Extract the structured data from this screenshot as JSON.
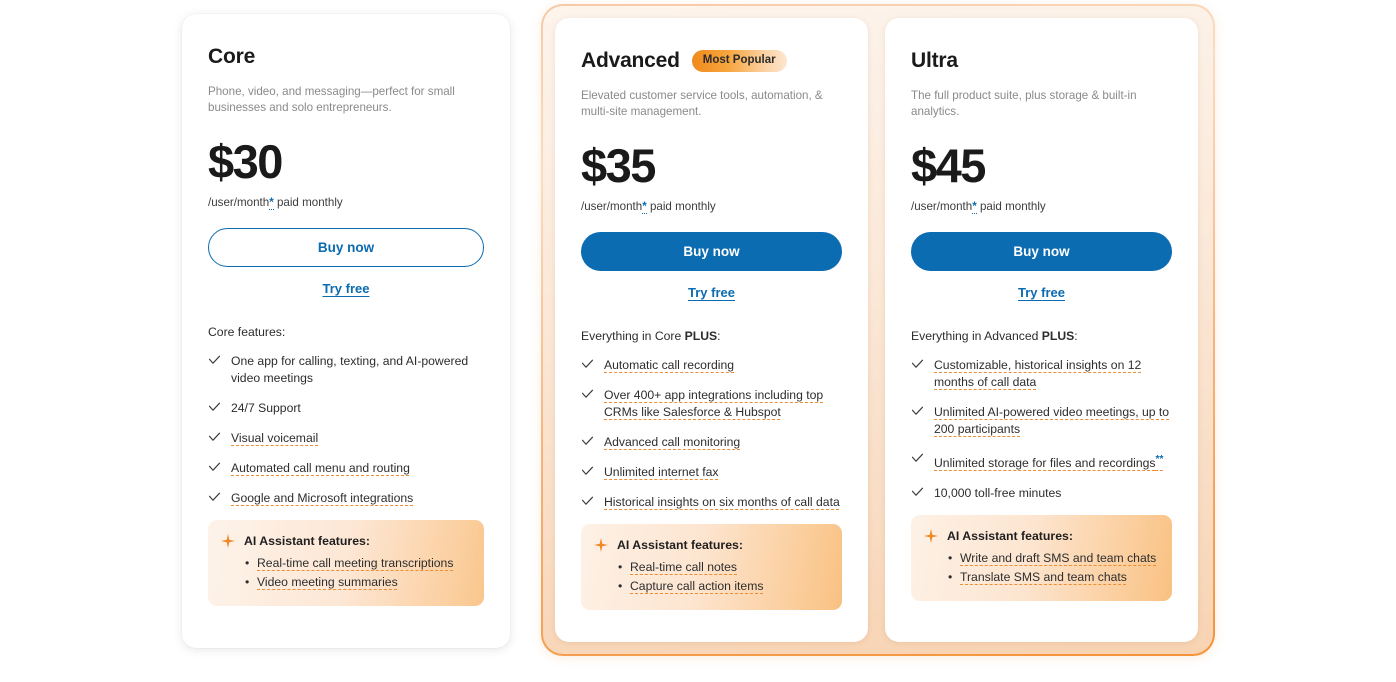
{
  "colors": {
    "brand_blue": "#0b6bb0",
    "accent_orange": "#ef8d33",
    "badge_orange": "#f08a1c",
    "text_dark": "#1a1a1a",
    "text_muted": "#8a8a8a"
  },
  "plans": [
    {
      "id": "core",
      "name": "Core",
      "badge": null,
      "description": "Phone, video, and messaging—perfect for small businesses and solo entrepreneurs.",
      "price": "$30",
      "price_note_prefix": "/user/month",
      "price_note_asterisk": "*",
      "price_note_suffix": " paid monthly",
      "buy_label": "Buy now",
      "try_label": "Try free",
      "features_intro": "Core features:",
      "features_intro_bold": "",
      "features_intro_suffix": "",
      "features": [
        {
          "text": "One app for calling, texting, and AI-powered video meetings",
          "dotted": false
        },
        {
          "text": "24/7 Support",
          "dotted": false
        },
        {
          "text": "Visual voicemail",
          "dotted": true
        },
        {
          "text": "Automated call menu and routing",
          "dotted": true
        },
        {
          "text": "Google and Microsoft integrations",
          "dotted": true
        }
      ],
      "ai": {
        "title": "AI Assistant features:",
        "items": [
          "Real-time call meeting transcriptions",
          "Video meeting summaries"
        ]
      }
    },
    {
      "id": "advanced",
      "name": "Advanced",
      "badge": "Most Popular",
      "description": "Elevated customer service tools, automation, & multi-site management.",
      "price": "$35",
      "price_note_prefix": "/user/month",
      "price_note_asterisk": "*",
      "price_note_suffix": " paid monthly",
      "buy_label": "Buy now",
      "try_label": "Try free",
      "features_intro": "Everything in Core ",
      "features_intro_bold": "PLUS",
      "features_intro_suffix": ":",
      "features": [
        {
          "text": "Automatic call recording",
          "dotted": true
        },
        {
          "text": "Over 400+ app integrations including top CRMs like Salesforce & Hubspot",
          "dotted": true
        },
        {
          "text": "Advanced call monitoring",
          "dotted": true
        },
        {
          "text": "Unlimited internet fax",
          "dotted": true
        },
        {
          "text": "Historical insights on six months of call data",
          "dotted": true
        }
      ],
      "ai": {
        "title": "AI Assistant features:",
        "items": [
          "Real-time call notes",
          "Capture call action items"
        ]
      }
    },
    {
      "id": "ultra",
      "name": "Ultra",
      "badge": null,
      "description": "The full product suite, plus storage & built-in analytics.",
      "price": "$45",
      "price_note_prefix": "/user/month",
      "price_note_asterisk": "*",
      "price_note_suffix": " paid monthly",
      "buy_label": "Buy now",
      "try_label": "Try free",
      "features_intro": "Everything in Advanced ",
      "features_intro_bold": "PLUS",
      "features_intro_suffix": ":",
      "features": [
        {
          "text": "Customizable, historical insights on 12 months of call data",
          "dotted": true
        },
        {
          "text": "Unlimited AI-powered video meetings, up to 200 participants",
          "dotted": true
        },
        {
          "text": "Unlimited storage for files and recordings",
          "dotted": true,
          "suffix": "**"
        },
        {
          "text": "10,000 toll-free minutes",
          "dotted": false
        }
      ],
      "ai": {
        "title": "AI Assistant features:",
        "items": [
          "Write and draft SMS and team chats",
          "Translate SMS and team chats"
        ]
      }
    }
  ]
}
